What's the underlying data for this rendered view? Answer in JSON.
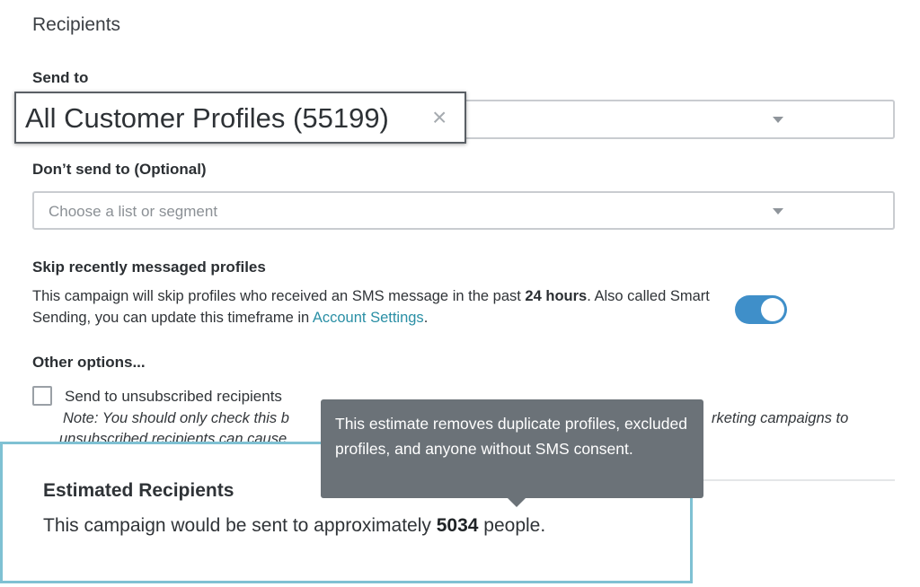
{
  "section_title": "Recipients",
  "send_to": {
    "label": "Send to",
    "selected_chip": "All Customer Profiles (55199)",
    "remove_symbol": "×"
  },
  "dont_send_to": {
    "label": "Don’t send to (Optional)",
    "placeholder": "Choose a list or segment"
  },
  "smart_sending": {
    "label": "Skip recently messaged profiles",
    "text_before": "This campaign will skip profiles who received an SMS message in the past ",
    "text_bold": "24 hours",
    "text_middle": ". Also called Smart Sending, you can update this timeframe in ",
    "link": "Account Settings",
    "text_after": ".",
    "toggle_on": true,
    "toggle_color": "#3f8fc9"
  },
  "other_options": {
    "label": "Other options...",
    "unsubscribed_checkbox_label": "Send to unsubscribed recipients",
    "unsubscribed_checked": false,
    "note_line1_start": "Note: You should only check this b",
    "note_line1_end": "rketing campaigns to",
    "note_line2_start": "unsubscribed recipients can cause"
  },
  "tooltip": {
    "text": "This estimate removes duplicate profiles, excluded profiles, and anyone without SMS consent."
  },
  "estimate": {
    "title": "Estimated Recipients",
    "text_before": "This campaign would be sent to approximately ",
    "count": "5034",
    "text_after": " people."
  },
  "colors": {
    "link": "#2a8fa5",
    "highlight_border": "#7fc1d3",
    "tooltip_bg": "#6b7278"
  }
}
